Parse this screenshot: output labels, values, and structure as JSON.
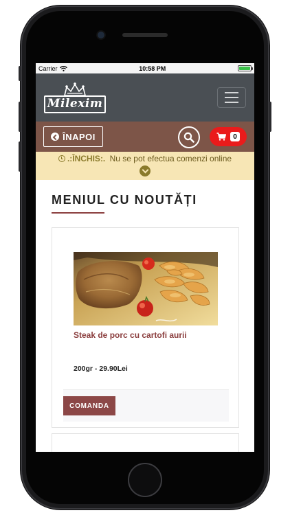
{
  "status_bar": {
    "carrier": "Carrier",
    "time": "10:58 PM",
    "battery_level": 1.0
  },
  "header": {
    "logo_text": "Milexim",
    "menu_icon": "hamburger-icon"
  },
  "nav": {
    "back_label": "ÎNAPOI",
    "back_icon": "chevron-left-circle-icon",
    "search_icon": "search-icon",
    "cart_icon": "shopping-cart-icon",
    "cart_count": "0",
    "cart_color": "#ea1b1b"
  },
  "notice": {
    "status": ".:ÎNCHIS:.",
    "message": " Nu se pot efectua comenzi online",
    "expand_icon": "chevron-down-icon"
  },
  "section": {
    "title": "MENIUL CU NOUTĂȚI"
  },
  "products": [
    {
      "name": "Steak de porc cu cartofi aurii",
      "price": "200gr - 29.90Lei",
      "order_label": "COMANDA"
    }
  ],
  "colors": {
    "topbar": "#4a4f54",
    "navbar": "#7d5548",
    "notice_bg": "#f7e6b5",
    "accent": "#8b3e3e"
  }
}
